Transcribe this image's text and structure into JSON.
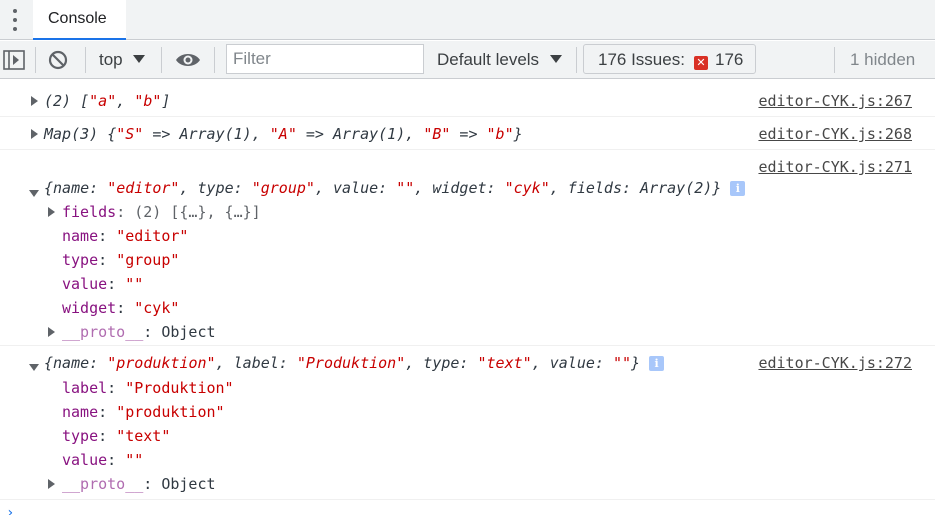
{
  "tabbar": {
    "tab_label": "Console"
  },
  "toolbar": {
    "context": "top",
    "filter_placeholder": "Filter",
    "levels": "Default levels",
    "issues_label": "176 Issues:",
    "issues_count": "176",
    "hidden": "1 hidden"
  },
  "messages": [
    {
      "source": "editor-CYK.js:267",
      "preview": "(2) [\"a\", \"b\"]",
      "parts": {
        "count": "(2) [",
        "a": "\"a\"",
        "comma": ", ",
        "b": "\"b\"",
        "end": "]"
      }
    },
    {
      "source": "editor-CYK.js:268",
      "parts": {
        "open": "Map(3) {",
        "s": "\"S\"",
        "arr1": " => Array(1), ",
        "a": "\"A\"",
        "arr2": " => Array(1), ",
        "b": "\"B\"",
        "arrow": " => ",
        "bv": "\"b\"",
        "close": "}"
      }
    },
    {
      "source": "editor-CYK.js:271",
      "summary": {
        "p1": "{name: ",
        "v1": "\"editor\"",
        "p2": ", type: ",
        "v2": "\"group\"",
        "p3": ", value: ",
        "v3": "\"\"",
        "p4": ", widget: ",
        "v4": "\"cyk\"",
        "p5": ", fields: Array(2)}"
      },
      "props": [
        {
          "key": "fields",
          "value": ": (2) [{…}, {…}]"
        },
        {
          "key": "name",
          "value": "\"editor\""
        },
        {
          "key": "type",
          "value": "\"group\""
        },
        {
          "key": "value",
          "value": "\"\""
        },
        {
          "key": "widget",
          "value": "\"cyk\""
        },
        {
          "key": "__proto__",
          "value": ": Object"
        }
      ]
    },
    {
      "source": "editor-CYK.js:272",
      "summary": {
        "p1": "{name: ",
        "v1": "\"produktion\"",
        "p2": ", label: ",
        "v2": "\"Produktion\"",
        "p3": ", type: ",
        "v3": "\"text\"",
        "p4": ", value: ",
        "v4": "\"\"",
        "p5": "}"
      },
      "props": [
        {
          "key": "label",
          "value": "\"Produktion\""
        },
        {
          "key": "name",
          "value": "\"produktion\""
        },
        {
          "key": "type",
          "value": "\"text\""
        },
        {
          "key": "value",
          "value": "\"\""
        },
        {
          "key": "__proto__",
          "value": ": Object"
        }
      ]
    }
  ],
  "colors": {
    "string": "#c80000",
    "accent": "#1a73e8",
    "error": "#d93025"
  }
}
